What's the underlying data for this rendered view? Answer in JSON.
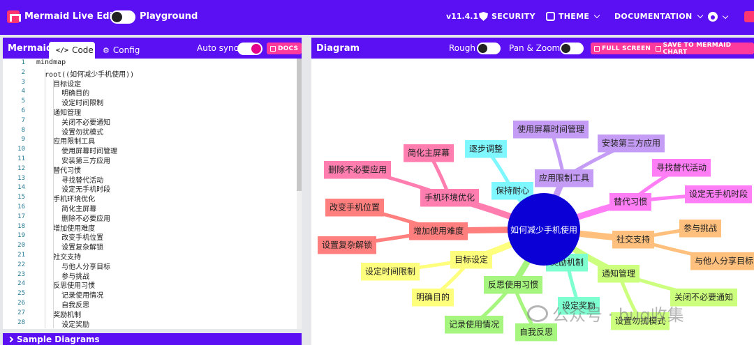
{
  "header": {
    "app_title": "Mermaid Live Editor",
    "playground": "Playground",
    "version": "v11.4.1",
    "security": "SECURITY",
    "theme": "THEME",
    "documentation": "DOCUMENTATION"
  },
  "editor_panel": {
    "title": "Mermaid",
    "tab_code": "Code",
    "tab_config": "Config",
    "auto_sync": "Auto sync",
    "docs": "DOCS",
    "code_lines": [
      "mindmap",
      "  root((如何减少手机使用))",
      "    目标设定",
      "      明确目的",
      "      设定时间限制",
      "    通知管理",
      "      关闭不必要通知",
      "      设置勿扰模式",
      "    应用限制工具",
      "      使用屏幕时间管理",
      "      安装第三方应用",
      "    替代习惯",
      "      寻找替代活动",
      "      设定无手机时段",
      "    手机环境优化",
      "      简化主屏幕",
      "      删除不必要应用",
      "    增加使用难度",
      "      改变手机位置",
      "      设置复杂解锁",
      "    社交支持",
      "      与他人分享目标",
      "      参与挑战",
      "    反思使用习惯",
      "      记录使用情况",
      "      自我反思",
      "    奖励机制",
      "      设定奖励"
    ],
    "sample_diagrams": "Sample Diagrams"
  },
  "diagram_panel": {
    "title": "Diagram",
    "rough": "Rough",
    "pan_zoom": "Pan & Zoom",
    "full_screen": "FULL SCREEN",
    "save_chart": "SAVE TO MERMAID CHART"
  },
  "mindmap": {
    "root": "如何减少手机使用",
    "root_color": "#0b00d6",
    "branches": [
      {
        "label": "应用限制工具",
        "color": "#c59cf5",
        "children": [
          "使用屏幕时间管理",
          "安装第三方应用"
        ]
      },
      {
        "label": "替代习惯",
        "color": "#ff7ef5",
        "children": [
          "寻找替代活动",
          "设定无手机时段"
        ]
      },
      {
        "label": "社交支持",
        "color": "#ffc07e",
        "children": [
          "参与挑战",
          "与他人分享目标"
        ]
      },
      {
        "label": "通知管理",
        "color": "#ccff7e",
        "children": [
          "关闭不必要通知",
          "设置勿扰模式"
        ]
      },
      {
        "label": "奖励机制",
        "color": "#7effd0",
        "children": [
          "设定奖励"
        ]
      },
      {
        "label": "反思使用习惯",
        "color": "#a6f57e",
        "children": [
          "记录使用情况",
          "自我反思"
        ]
      },
      {
        "label": "目标设定",
        "color": "#ffff7e",
        "children": [
          "设定时间限制",
          "明确目的"
        ]
      },
      {
        "label": "增加使用难度",
        "color": "#ff7e7e",
        "children": [
          "改变手机位置",
          "设置复杂解锁"
        ]
      },
      {
        "label": "手机环境优化",
        "color": "#ff7eaf",
        "children": [
          "简化主屏幕",
          "删除不必要应用"
        ]
      },
      {
        "label": "保持耐心",
        "color": "#7ef7ff",
        "children": [
          "逐步调整"
        ]
      }
    ]
  },
  "watermark": "公众号 · bug收集"
}
